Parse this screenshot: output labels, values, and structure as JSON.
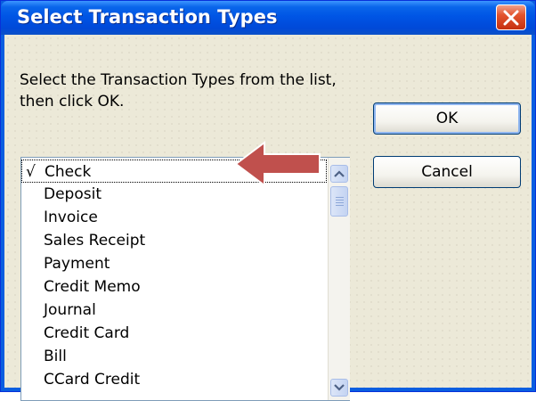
{
  "window": {
    "title": "Select Transaction Types"
  },
  "instructions": "Select the Transaction Types from the list, then click OK.",
  "buttons": {
    "ok_label": "OK",
    "cancel_label": "Cancel"
  },
  "list": {
    "items": [
      {
        "label": "Check",
        "checked": true,
        "check_mark": "√"
      },
      {
        "label": "Deposit",
        "checked": false,
        "check_mark": ""
      },
      {
        "label": "Invoice",
        "checked": false,
        "check_mark": ""
      },
      {
        "label": "Sales Receipt",
        "checked": false,
        "check_mark": ""
      },
      {
        "label": "Payment",
        "checked": false,
        "check_mark": ""
      },
      {
        "label": "Credit Memo",
        "checked": false,
        "check_mark": ""
      },
      {
        "label": "Journal",
        "checked": false,
        "check_mark": ""
      },
      {
        "label": "Credit Card",
        "checked": false,
        "check_mark": ""
      },
      {
        "label": "Bill",
        "checked": false,
        "check_mark": ""
      },
      {
        "label": "CCard Credit",
        "checked": false,
        "check_mark": ""
      }
    ]
  },
  "colors": {
    "titlebar": "#0055e5",
    "close_button": "#e3542d",
    "dialog_background": "#ece9d8",
    "annotation_arrow": "#c0504d"
  },
  "icons": {
    "close": "close-x-icon",
    "scroll_up": "chevron-up-icon",
    "scroll_down": "chevron-down-icon",
    "annotation": "left-arrow-icon"
  }
}
